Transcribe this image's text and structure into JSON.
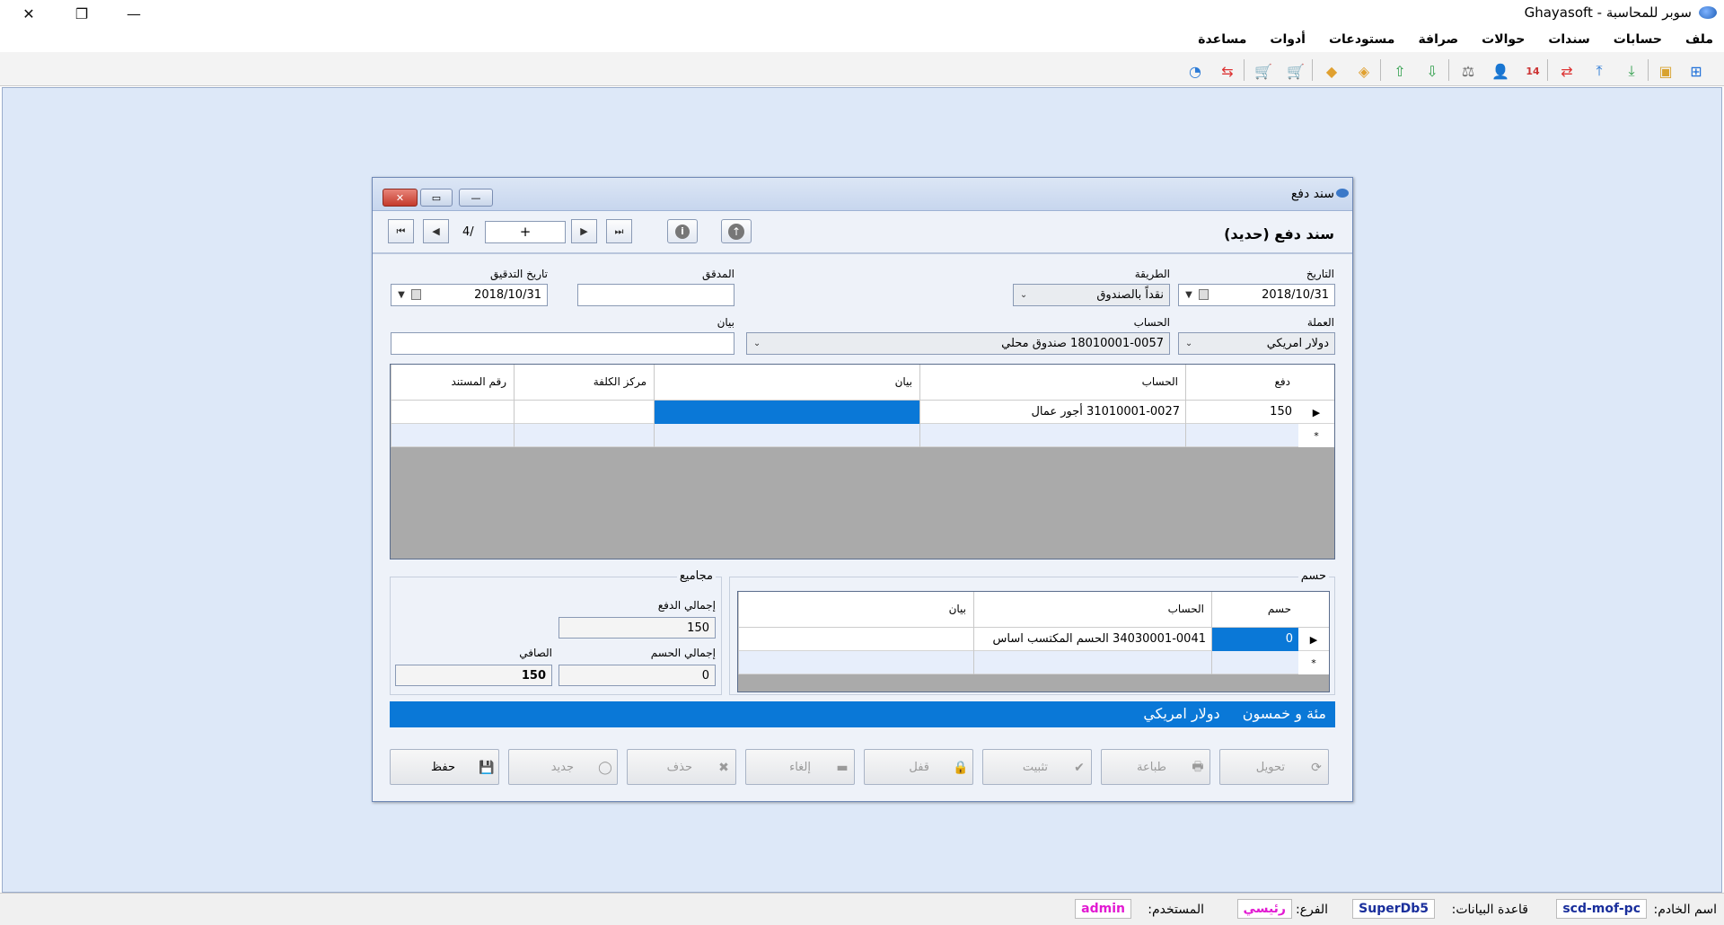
{
  "app": {
    "title": "سوبر للمحاسبة - Ghayasoft"
  },
  "menu": [
    "ملف",
    "حسابات",
    "سندات",
    "حوالات",
    "صرافة",
    "مستودعات",
    "أدوات",
    "مساعدة"
  ],
  "toolbar_icons": [
    "network-icon",
    "image-icon",
    "download-icon",
    "upload-icon",
    "exchange-icon",
    "calendar-icon",
    "user-icon",
    "scales-icon",
    "export-down-icon",
    "export-up-icon",
    "eraser-icon",
    "tag-icon",
    "cart-icon",
    "cart-remove-icon",
    "transfer-icon",
    "pie-icon"
  ],
  "dialog": {
    "title": "سند دفع",
    "header": "سند دفع (حديد)",
    "nav": {
      "record_count": "4/",
      "record_value": "+"
    },
    "fields": {
      "date_label": "التاريخ",
      "date_value": "2018/10/31",
      "method_label": "الطريقة",
      "method_value": "نقداً بالصندوق",
      "auditor_label": "المدقق",
      "auditor_value": "",
      "audit_date_label": "تاريخ التدقيق",
      "audit_date_value": "2018/10/31",
      "currency_label": "العملة",
      "currency_value": "دولار امريكي",
      "account_label": "الحساب",
      "account_value": "18010001-0057 صندوق محلي",
      "statement_label": "بيان",
      "statement_value": ""
    },
    "grid": {
      "headers": {
        "payment": "دفع",
        "account": "الحساب",
        "statement": "بيان",
        "cost_center": "مركز الكلفة",
        "doc_number": "رقم المستند"
      },
      "rows": [
        {
          "payment": "150",
          "account": "31010001-0027 أجور عمال",
          "statement": "",
          "cost_center": "",
          "doc_number": ""
        }
      ],
      "new_row_marker": "*"
    },
    "discount": {
      "title": "حسم",
      "headers": {
        "discount": "حسم",
        "account": "الحساب",
        "statement": "بيان"
      },
      "rows": [
        {
          "discount": "0",
          "account": "34030001-0041 الحسم المكتسب اساس",
          "statement": ""
        }
      ]
    },
    "totals": {
      "title": "مجاميع",
      "total_payment_label": "إجمالي الدفع",
      "total_payment_value": "150",
      "total_discount_label": "إجمالي الحسم",
      "total_discount_value": "0",
      "net_label": "الصافي",
      "net_value": "150"
    },
    "amount_words": "مئة و خمسون",
    "amount_currency": "دولار امريكي",
    "buttons": {
      "save": "حفظ",
      "new": "جديد",
      "delete": "حذف",
      "cancel": "إلغاء",
      "lock": "قفل",
      "post": "تثبيت",
      "print": "طباعة",
      "convert": "تحويل"
    }
  },
  "status": {
    "server_label": "اسم الخادم:",
    "server_value": "scd-mof-pc",
    "db_label": "قاعدة البيانات:",
    "db_value": "SuperDb5",
    "branch_label": "الفرع:",
    "branch_value": "رئيسي",
    "user_label": "المستخدم:",
    "user_value": "admin"
  },
  "colors": {
    "accent_blue": "#0a78d7",
    "workspace": "#dde8f8",
    "status_server": "#1a2f9c",
    "status_user": "#e21ad2"
  }
}
